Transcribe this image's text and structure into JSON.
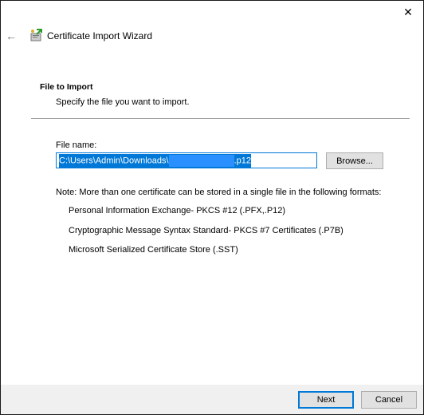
{
  "window": {
    "close_glyph": "✕",
    "back_glyph": "←",
    "title": "Certificate Import Wizard"
  },
  "page": {
    "heading": "File to Import",
    "subtitle": "Specify the file you want to import."
  },
  "file": {
    "label": "File name:",
    "path_prefix": "C:\\Users\\Admin\\Downloads\\",
    "path_suffix": ".p12"
  },
  "browse_label": "Browse...",
  "note": "Note:  More than one certificate can be stored in a single file in the following formats:",
  "formats": [
    "Personal Information Exchange- PKCS #12 (.PFX,.P12)",
    "Cryptographic Message Syntax Standard- PKCS #7 Certificates (.P7B)",
    "Microsoft Serialized Certificate Store (.SST)"
  ],
  "footer": {
    "next_label": "Next",
    "cancel_label": "Cancel"
  },
  "colors": {
    "accent": "#0078d7",
    "button_face": "#e1e1e1",
    "footer_bg": "#f0f0f0"
  },
  "icons": {
    "close": "close-icon",
    "back": "back-arrow-icon",
    "wizard": "certificate-wizard-icon"
  }
}
